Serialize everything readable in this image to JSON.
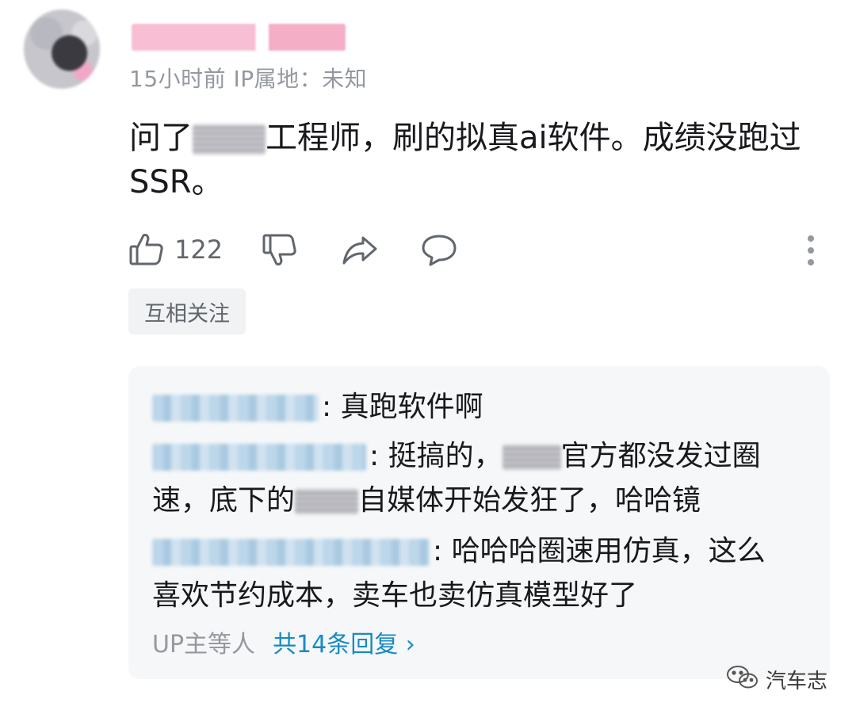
{
  "comment": {
    "meta": "15小时前  IP属地：未知",
    "text_part1": "问了",
    "text_part2": "工程师，刷的拟真ai软件。成绩没跑过SSR。",
    "like_count": "122",
    "tag": "互相关注"
  },
  "replies": [
    {
      "text": ": 真跑软件啊"
    },
    {
      "text_part1": ": 挺搞的，",
      "text_part2": "官方都没发过圈",
      "line2_part1": "速，底下的",
      "line2_part2": "自媒体开始发狂了，哈哈镜"
    },
    {
      "text": ": 哈哈哈圈速用仿真，这么",
      "line2": "喜欢节约成本，卖车也卖仿真模型好了"
    }
  ],
  "reply_footer": {
    "participants": "UP主等人",
    "count": "共14条回复 ›"
  },
  "watermark": {
    "text": "汽车志",
    "icon": "wechat-icon"
  },
  "icons": [
    "thumb-up-icon",
    "thumb-down-icon",
    "share-icon",
    "comment-icon",
    "more-vertical-icon"
  ]
}
